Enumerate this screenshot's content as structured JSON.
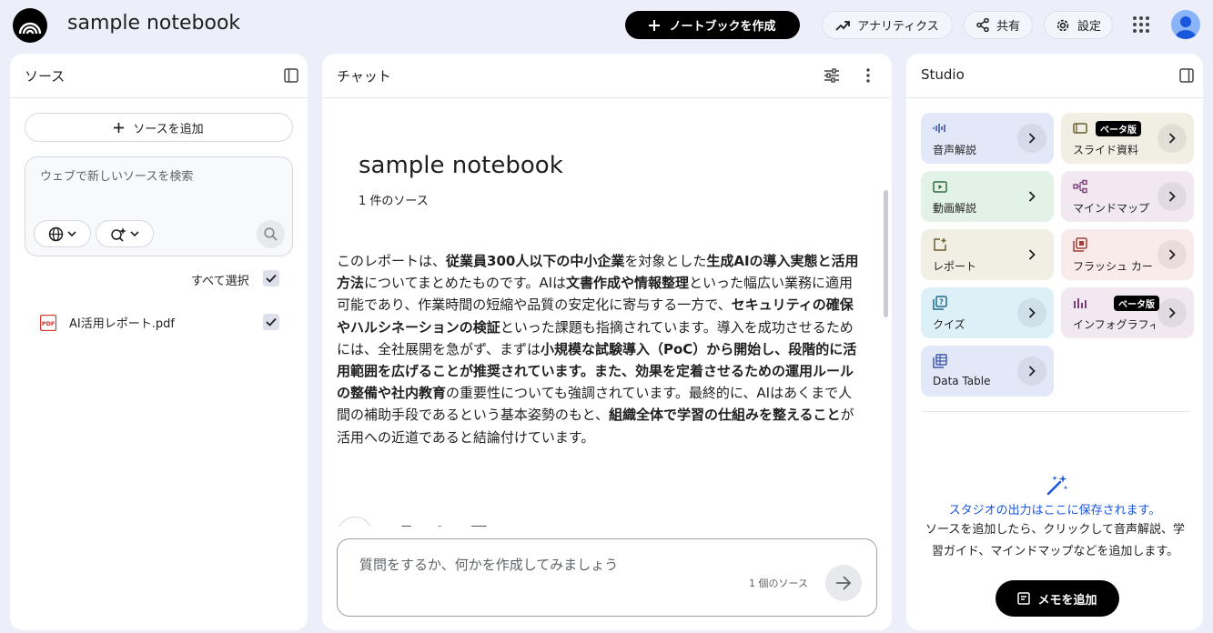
{
  "topbar": {
    "title": "sample notebook",
    "create_label": "ノートブックを作成",
    "analytics_label": "アナリティクス",
    "share_label": "共有",
    "settings_label": "設定"
  },
  "sources": {
    "title": "ソース",
    "add_label": "ソースを追加",
    "search_placeholder": "ウェブで新しいソースを検索",
    "select_all_label": "すべて選択",
    "items": [
      {
        "name": "AI活用レポート.pdf",
        "type": "pdf",
        "checked": true
      }
    ]
  },
  "chat": {
    "title": "チャット",
    "notebook_title": "sample notebook",
    "source_count": "1 件のソース",
    "summary": {
      "s1": "このレポートは、",
      "b1": "従業員300人以下の中小企業",
      "s2": "を対象とした",
      "b2": "生成AIの導入実態と活用方法",
      "s3": "についてまとめたものです。AIは",
      "b3": "文書作成や情報整理",
      "s4": "といった幅広い業務に適用可能であり、作業時間の短縮や品質の安定化に寄与する一方で、",
      "b4": "セキュリティの確保やハルシネーションの検証",
      "s5": "といった課題も指摘されています。導入を成功させるためには、全社展開を急がず、まずは",
      "b5": "小規模な試験導入（PoC）から開始し、段階的に活用範囲を広げることが推奨されています。また、効果を定着させるための運用ルールの整備や社内教育",
      "s6": "の重要性についても強調されています。最終的に、AIはあくまで人間の補助手段であるという基本姿勢のもと、",
      "b6": "組織全体で学習の仕組みを整えること",
      "s7": "が活用への近道であると結論付けています。"
    },
    "input_placeholder": "質問をするか、何かを作成してみましょう",
    "input_source_count": "1 個のソース"
  },
  "studio": {
    "title": "Studio",
    "tiles": [
      {
        "label": "音声解説",
        "icon": "audio-wave-icon",
        "bg": "#e3e8f8",
        "beta": false
      },
      {
        "label": "スライド資料",
        "icon": "slides-icon",
        "bg": "#f1efe4",
        "beta": true
      },
      {
        "label": "動画解説",
        "icon": "video-icon",
        "bg": "#e2f2e6",
        "beta": false
      },
      {
        "label": "マインドマップ",
        "icon": "mindmap-icon",
        "bg": "#f1e8f1",
        "beta": false
      },
      {
        "label": "レポート",
        "icon": "report-icon",
        "bg": "#f1efe4",
        "beta": false
      },
      {
        "label": "フラッシュ カード",
        "icon": "flashcard-icon",
        "bg": "#f8ebea",
        "beta": false
      },
      {
        "label": "クイズ",
        "icon": "quiz-icon",
        "bg": "#ddeff7",
        "beta": false
      },
      {
        "label": "インフォグラフィック",
        "icon": "infographic-icon",
        "bg": "#f1e8f1",
        "beta": true
      },
      {
        "label": "Data Table",
        "icon": "table-icon",
        "bg": "#e3e8f8",
        "beta": false
      }
    ],
    "beta_label": "ベータ版",
    "empty_title": "スタジオの出力はここに保存されます。",
    "empty_desc": "ソースを追加したら、クリックして音声解説、学習ガイド、マインドマップなどを追加します。",
    "memo_label": "メモを追加"
  }
}
